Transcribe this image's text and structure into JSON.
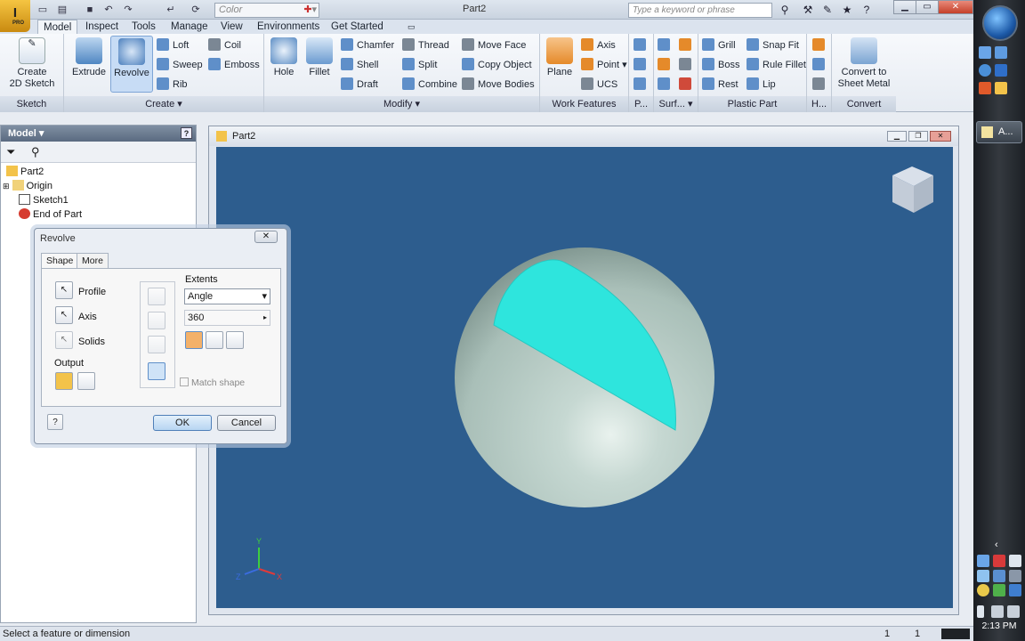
{
  "app": {
    "window_title": "Part2",
    "color_box": "Color",
    "search_placeholder": "Type a keyword or phrase"
  },
  "tabs": [
    "Model",
    "Inspect",
    "Tools",
    "Manage",
    "View",
    "Environments",
    "Get Started"
  ],
  "ribbon": {
    "sketch": {
      "create_sketch": "Create\n2D Sketch",
      "title": "Sketch"
    },
    "create": {
      "extrude": "Extrude",
      "revolve": "Revolve",
      "loft": "Loft",
      "sweep": "Sweep",
      "rib": "Rib",
      "coil": "Coil",
      "emboss": "Emboss",
      "title": "Create"
    },
    "modify": {
      "hole": "Hole",
      "fillet": "Fillet",
      "chamfer": "Chamfer",
      "shell": "Shell",
      "draft": "Draft",
      "thread": "Thread",
      "split": "Split",
      "combine": "Combine",
      "move_face": "Move Face",
      "copy_object": "Copy Object",
      "move_bodies": "Move Bodies",
      "title": "Modify"
    },
    "work": {
      "plane": "Plane",
      "axis": "Axis",
      "point": "Point",
      "ucs": "UCS",
      "title": "Work Features"
    },
    "p": {
      "title": "P..."
    },
    "surf": {
      "title": "Surf..."
    },
    "plastic": {
      "grill": "Grill",
      "boss": "Boss",
      "rest": "Rest",
      "snap_fit": "Snap Fit",
      "rule_fillet": "Rule Fillet",
      "lip": "Lip",
      "title": "Plastic Part"
    },
    "h": {
      "title": "H..."
    },
    "convert": {
      "convert_sheet_metal": "Convert to\nSheet Metal",
      "title": "Convert"
    }
  },
  "browser": {
    "title": "Model",
    "items": [
      "Part2",
      "Origin",
      "Sketch1",
      "End of Part"
    ]
  },
  "viewport": {
    "title": "Part2",
    "axis_labels": [
      "Y",
      "X",
      "Z"
    ]
  },
  "dialog": {
    "title": "Revolve",
    "tab_shape": "Shape",
    "tab_more": "More",
    "profile": "Profile",
    "axis": "Axis",
    "solids": "Solids",
    "output": "Output",
    "extents": "Extents",
    "extents_value": "Angle",
    "angle_value": "360",
    "match_shape": "Match shape",
    "ok": "OK",
    "cancel": "Cancel"
  },
  "status": {
    "message": "Select a feature or dimension",
    "count1": "1",
    "count2": "1"
  },
  "taskbar": {
    "task_label": "A...",
    "time": "2:13 PM"
  }
}
